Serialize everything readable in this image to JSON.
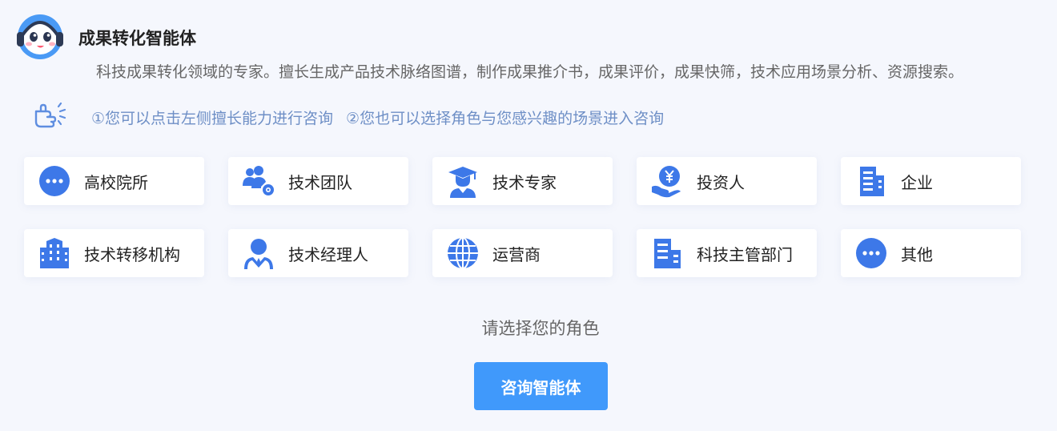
{
  "agent": {
    "title": "成果转化智能体",
    "description": "科技成果转化领域的专家。擅长生成产品技术脉络图谱，制作成果推介书，成果评价，成果快筛，技术应用场景分析、资源搜索。"
  },
  "hints": [
    "①您可以点击左侧擅长能力进行咨询",
    "②您也可以选择角色与您感兴趣的场景进入咨询"
  ],
  "roles": [
    {
      "label": "高校院所",
      "icon": "more-circle-icon"
    },
    {
      "label": "技术团队",
      "icon": "team-icon"
    },
    {
      "label": "技术专家",
      "icon": "graduate-icon"
    },
    {
      "label": "投资人",
      "icon": "investor-icon"
    },
    {
      "label": "企业",
      "icon": "building-icon"
    },
    {
      "label": "技术转移机构",
      "icon": "institution-icon"
    },
    {
      "label": "技术经理人",
      "icon": "manager-icon"
    },
    {
      "label": "运营商",
      "icon": "globe-icon"
    },
    {
      "label": "科技主管部门",
      "icon": "department-icon"
    },
    {
      "label": "其他",
      "icon": "more-circle-icon"
    }
  ],
  "prompt": "请选择您的角色",
  "consult_button": "咨询智能体",
  "colors": {
    "accent": "#4099fb",
    "icon": "#3d78e8",
    "hint": "#6e8fc6",
    "background": "#f5f7fd"
  }
}
